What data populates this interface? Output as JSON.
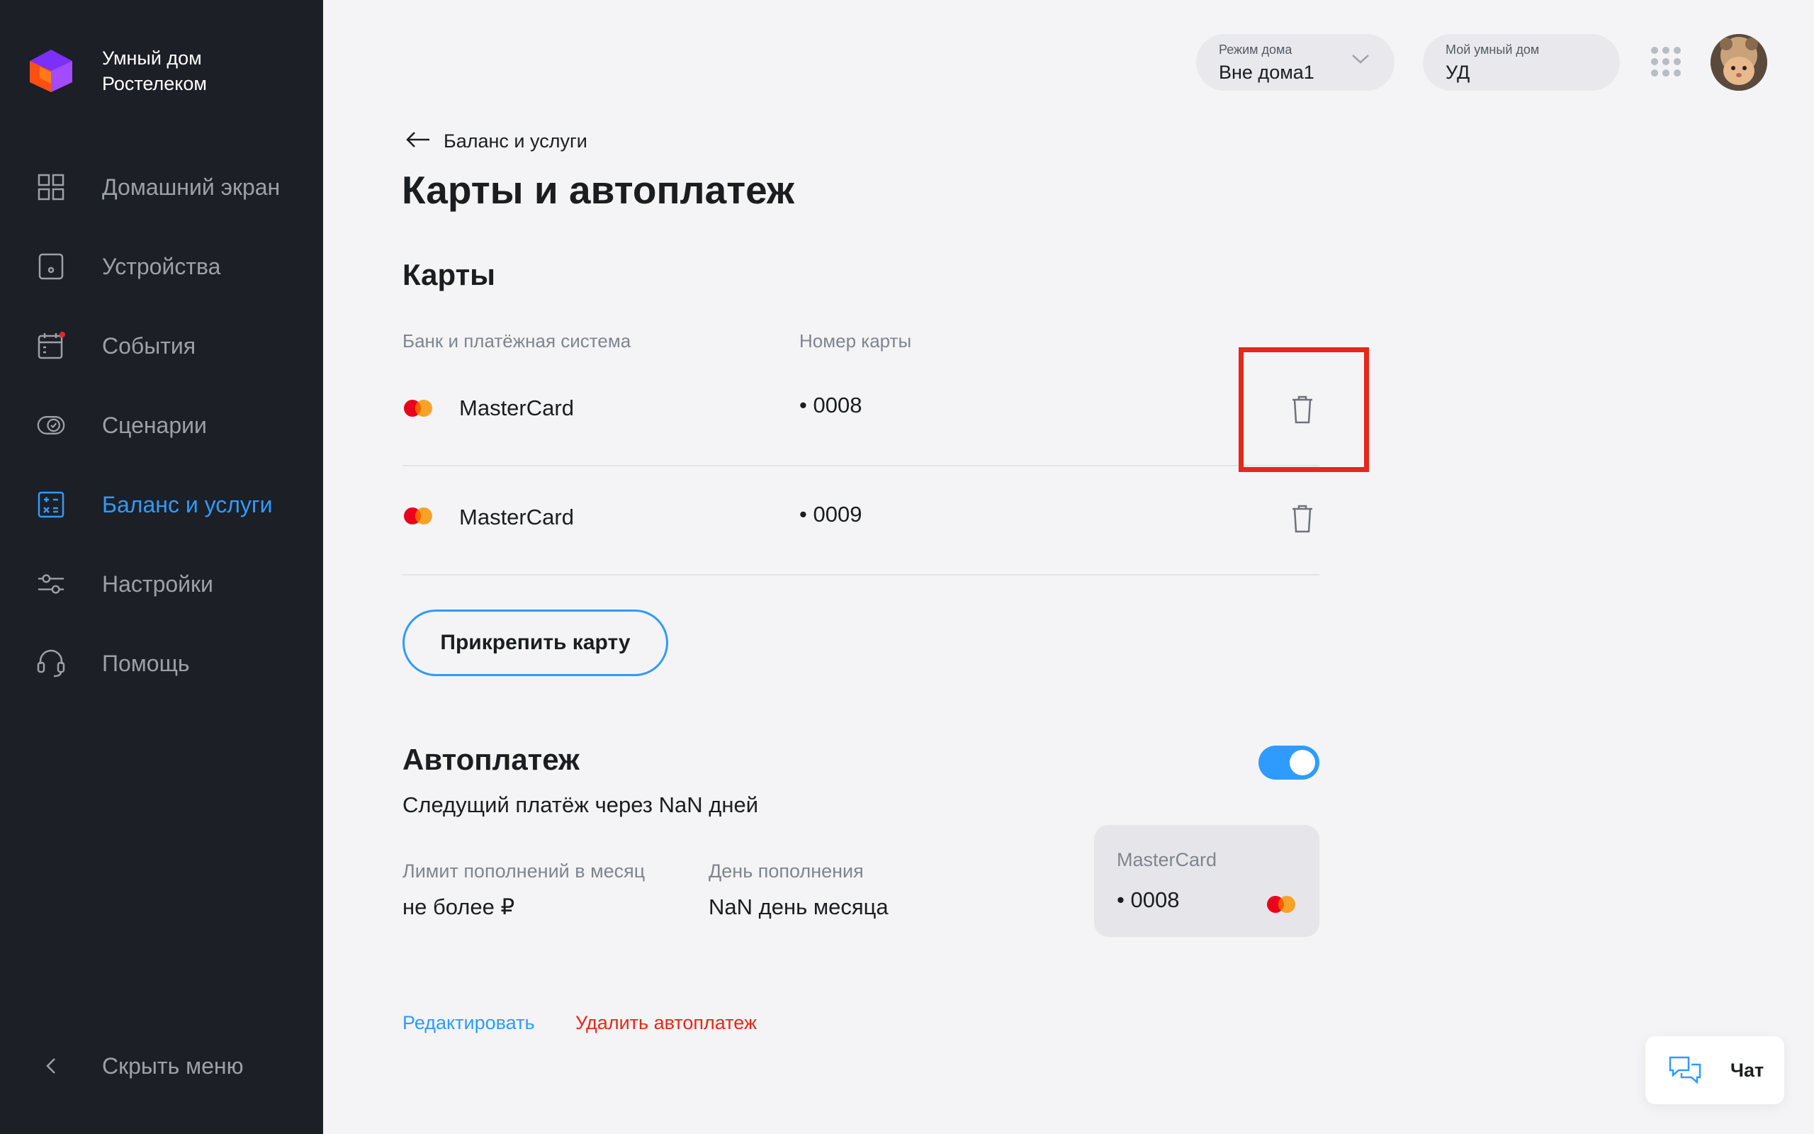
{
  "app": {
    "name_line1": "Умный дом",
    "name_line2": "Ростелеком"
  },
  "sidebar": {
    "items": [
      {
        "label": "Домашний экран",
        "icon": "grid-icon"
      },
      {
        "label": "Устройства",
        "icon": "device-icon"
      },
      {
        "label": "События",
        "icon": "calendar-icon",
        "badge": true
      },
      {
        "label": "Сценарии",
        "icon": "scenario-icon"
      },
      {
        "label": "Баланс и услуги",
        "icon": "calculator-icon",
        "active": true
      },
      {
        "label": "Настройки",
        "icon": "sliders-icon"
      },
      {
        "label": "Помощь",
        "icon": "headset-icon"
      }
    ],
    "collapse_label": "Скрыть меню"
  },
  "topbar": {
    "mode": {
      "label": "Режим дома",
      "value": "Вне дома1"
    },
    "home": {
      "label": "Мой умный дом",
      "value": "УД"
    }
  },
  "page": {
    "back_label": "Баланс и услуги",
    "title": "Карты и автоплатеж"
  },
  "cards": {
    "section_title": "Карты",
    "col_bank": "Банк и платёжная система",
    "col_number": "Номер карты",
    "rows": [
      {
        "bank": "MasterCard",
        "number": "• 0008"
      },
      {
        "bank": "MasterCard",
        "number": "• 0009"
      }
    ],
    "attach_label": "Прикрепить карту"
  },
  "autopay": {
    "title": "Автоплатеж",
    "enabled": true,
    "next_payment": "Следущий платёж через NaN дней",
    "limit_label": "Лимит пополнений в месяц",
    "limit_value": "не более ₽",
    "day_label": "День пополнения",
    "day_value": "NaN день месяца",
    "card": {
      "name": "MasterCard",
      "number": "• 0008"
    },
    "edit_label": "Редактировать",
    "delete_label": "Удалить автоплатеж"
  },
  "chat": {
    "label": "Чат"
  },
  "colors": {
    "accent": "#2f9bff",
    "danger": "#e8261c",
    "sidebar_bg": "#1c1f26",
    "page_bg": "#f4f4f6"
  }
}
